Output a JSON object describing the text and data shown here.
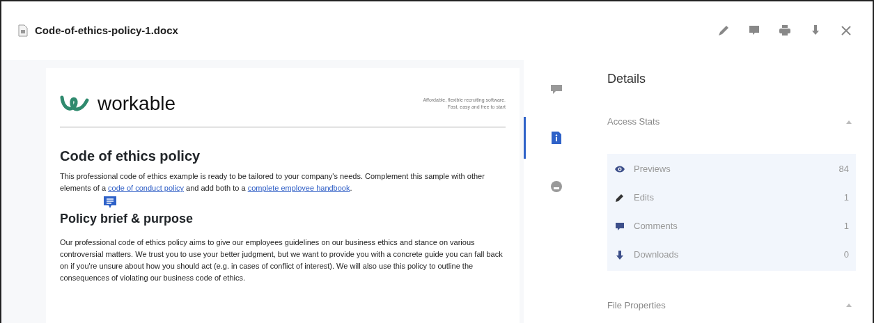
{
  "window": {
    "title": "Code-of-ethics-policy-1.docx"
  },
  "toolbar": [
    {
      "kind": "edit"
    },
    {
      "kind": "comment"
    },
    {
      "kind": "print"
    },
    {
      "kind": "download"
    },
    {
      "kind": "close"
    }
  ],
  "document": {
    "brand": "workable",
    "tagline": [
      "Affordable, flexible recruiting software.",
      "Fast, easy and free to start"
    ],
    "heading": "Code of ethics policy",
    "intro": [
      {
        "text": "This professional code of ethics example is ready to be tailored to your company's needs. Complement this sample with other elements of a ",
        "kind": "text"
      },
      {
        "text": "code of conduct policy",
        "kind": "link"
      },
      {
        "text": " and add both to a ",
        "kind": "text"
      },
      {
        "text": "complete employee handbook",
        "kind": "link"
      },
      {
        "text": ".",
        "kind": "text"
      }
    ],
    "subheading": "Policy brief & purpose",
    "comment_marker": true,
    "body": "Our professional code of ethics policy aims to give our employees guidelines on our business ethics and stance on various controversial matters. We trust you to use your better judgment, but we want to provide you with a concrete guide you can fall back on if you're unsure about how you should act (e.g. in cases of conflict of interest). We will also use this policy to outline the consequences of violating our business code of ethics."
  },
  "side_tabs": [
    {
      "kind": "comments",
      "selected": false
    },
    {
      "kind": "info",
      "selected": true
    },
    {
      "kind": "activity",
      "selected": false
    }
  ],
  "details": {
    "title": "Details",
    "sections": [
      {
        "title": "Access Stats",
        "expanded": true,
        "items": [
          {
            "kind": "previews",
            "label": "Previews",
            "value": "84"
          },
          {
            "kind": "edits",
            "label": "Edits",
            "value": "1"
          },
          {
            "kind": "comments",
            "label": "Comments",
            "value": "1"
          },
          {
            "kind": "downloads",
            "label": "Downloads",
            "value": "0"
          }
        ]
      },
      {
        "title": "File Properties",
        "expanded": true
      }
    ]
  }
}
